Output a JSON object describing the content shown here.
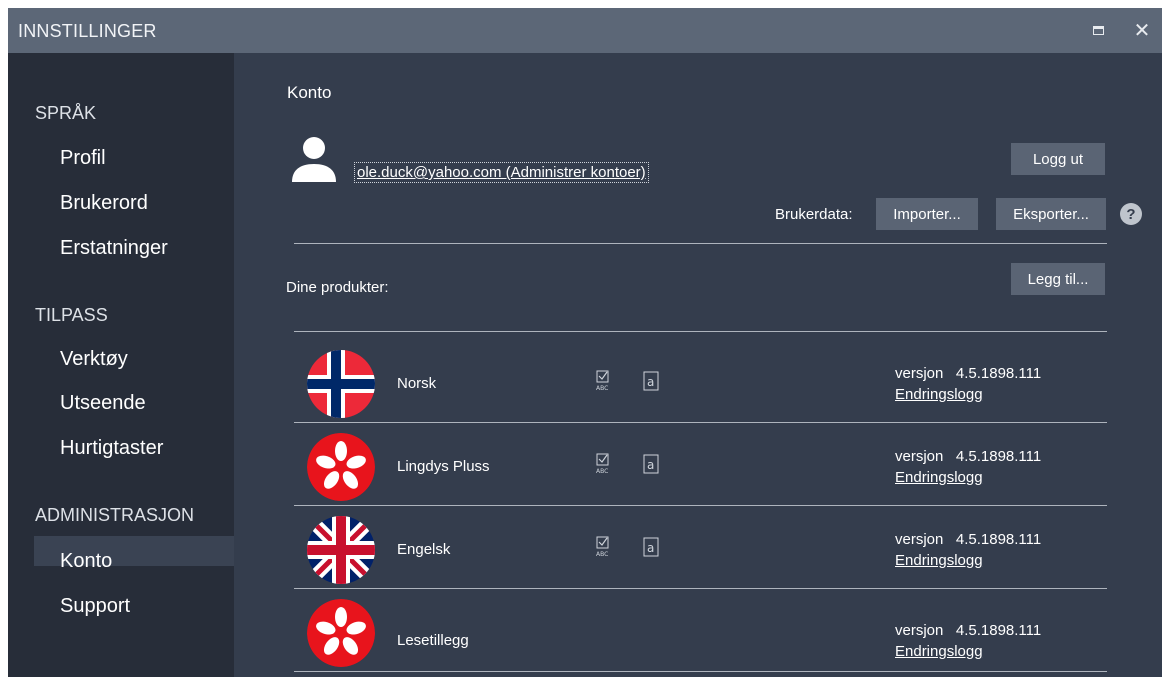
{
  "window": {
    "title": "INNSTILLINGER",
    "maximize_icon": "maximize-icon",
    "close_glyph": "✕"
  },
  "sidebar": {
    "sections": [
      {
        "label": "SPRÅK",
        "items": [
          "Profil",
          "Brukerord",
          "Erstatninger"
        ]
      },
      {
        "label": "TILPASS",
        "items": [
          "Verktøy",
          "Utseende",
          "Hurtigtaster"
        ]
      },
      {
        "label": "ADMINISTRASJON",
        "items": [
          "Konto",
          "Support"
        ]
      }
    ],
    "active_item": "Konto"
  },
  "account": {
    "title": "Konto",
    "email_link": "ole.duck@yahoo.com (Administrer kontoer)",
    "logout_label": "Logg ut",
    "userdata_label": "Brukerdata:",
    "import_label": "Importer...",
    "export_label": "Eksporter...",
    "help_glyph": "?"
  },
  "products": {
    "label": "Dine produkter:",
    "add_label": "Legg til...",
    "items": [
      {
        "name": "Norsk",
        "flag": "norway-flag",
        "version_prefix": "versjon",
        "version": "4.5.1898.111",
        "changelog": "Endringslogg",
        "has_tool_icons": true
      },
      {
        "name": "Lingdys Pluss",
        "flag": "lingdys-logo",
        "version_prefix": "versjon",
        "version": "4.5.1898.111",
        "changelog": "Endringslogg",
        "has_tool_icons": true
      },
      {
        "name": "Engelsk",
        "flag": "uk-flag",
        "version_prefix": "versjon",
        "version": "4.5.1898.111",
        "changelog": "Endringslogg",
        "has_tool_icons": true
      },
      {
        "name": "Lesetillegg",
        "flag": "lingdys-logo",
        "version_prefix": "versjon",
        "version": "4.5.1898.111",
        "changelog": "Endringslogg",
        "has_tool_icons": false
      }
    ]
  },
  "colors": {
    "titlebar": "#5c6777",
    "sidebar": "#272d39",
    "content": "#343d4d",
    "button": "#5a6474",
    "logo_red": "#e8141c"
  }
}
